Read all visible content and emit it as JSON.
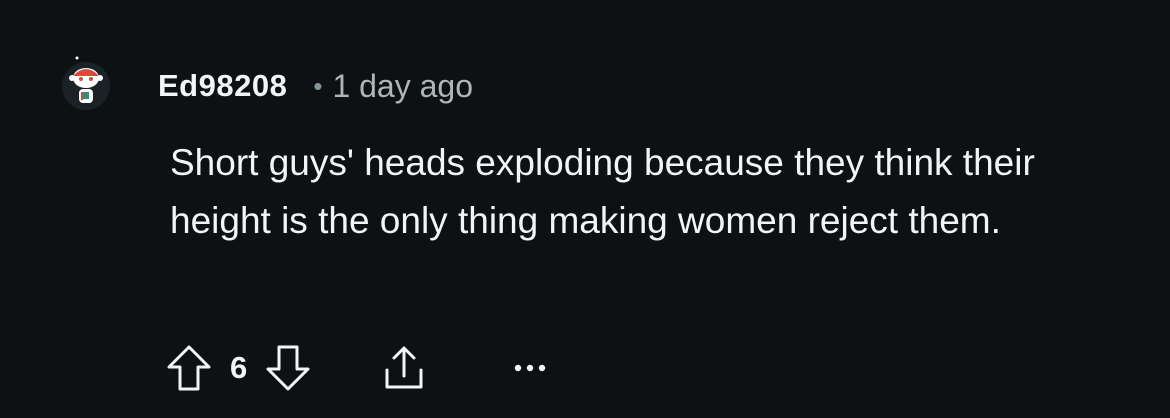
{
  "comment": {
    "author": "Ed98208",
    "separator": "•",
    "timestamp": "1 day ago",
    "body": "Short guys' heads exploding because they think their height is the only thing making women reject them.",
    "score": "6"
  },
  "icons": {
    "avatar": "reddit-snoo-avatar-icon",
    "upvote": "arrow-up-icon",
    "downvote": "arrow-down-icon",
    "share": "share-icon",
    "more": "more-options-icon"
  },
  "colors": {
    "background": "#0e1113",
    "text": "#f2f4f5",
    "meta": "#aeb6ba"
  }
}
